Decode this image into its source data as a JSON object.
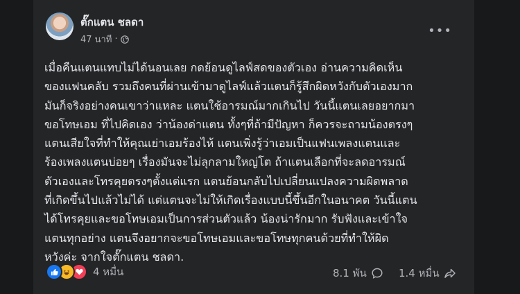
{
  "post": {
    "author": "ตั๊กแตน ชลดา",
    "time": "47 นาที",
    "audience_icon": "globe-icon",
    "lines": [
      "เมื่อคืนแตนแทบไม่ได้นอนเลย กดย้อนดูไลฟ์สดของตัวเอง อ่านความคิดเห็น",
      "ของแฟนคลับ รวมถึงคนที่ผ่านเข้ามาดูไลฟ์แล้วแตนก็รู้สึกผิดหวังกับตัวเองมาก",
      "มันก็จริงอย่างคนเขาว่าแหละ แตนใช้อารมณ์มากเกินไป วันนี้แตนเลยอยากมา",
      "ขอโทษเอม ที่ไปคิดเอง ว่าน้องด่าแตน ทั้งๆที่ถ้ามีปัญหา ก็ควรจะถามน้องตรงๆ",
      "แตนเสียใจที่ทำให้คุณเย่าเอมร้องไห้ แตนเพิ่งรู้ว่าเอมเป็นแฟนเพลงแตนและ",
      "ร้องเพลงแตนบ่อยๆ เรื่องมันจะไม่ลุกลามใหญ่โต ถ้าแตนเลือกที่จะลดอารมณ์",
      "ตัวเองและโทรคุยตรงๆตั้งแต่แรก แตนย้อนกลับไปเปลี่ยนแปลงความผิดพลาด",
      "ที่เกิดขึ้นไปแล้วไม่ได้ แต่แตนจะไม่ให้เกิดเรื่องแบบนี้ขึ้นอีกในอนาคต วันนี้แตน",
      "ได้โทรคุยและขอโทษเอมเป็นการส่วนตัวแล้ว น้องน่ารักมาก รับฟังและเข้าใจ",
      "แตนทุกอย่าง แตนจึงอยากจะขอโทษเอมและขอโทษทุกคนด้วยที่ทำให้ผิด",
      "หวังค่ะ จากใจตั๊กแตน ชลดา."
    ]
  },
  "stats": {
    "reaction_icons": [
      "like-icon",
      "haha-icon",
      "love-icon"
    ],
    "reactions": "4 หมื่น",
    "comments": "8.1 พัน",
    "shares": "1.4 หมื่น"
  },
  "colors": {
    "background": "#18191a",
    "card": "#242526",
    "text": "#e4e6eb",
    "secondary": "#b0b3b8",
    "like": "#1877f2",
    "haha": "#f7b928",
    "love": "#f33e58"
  }
}
